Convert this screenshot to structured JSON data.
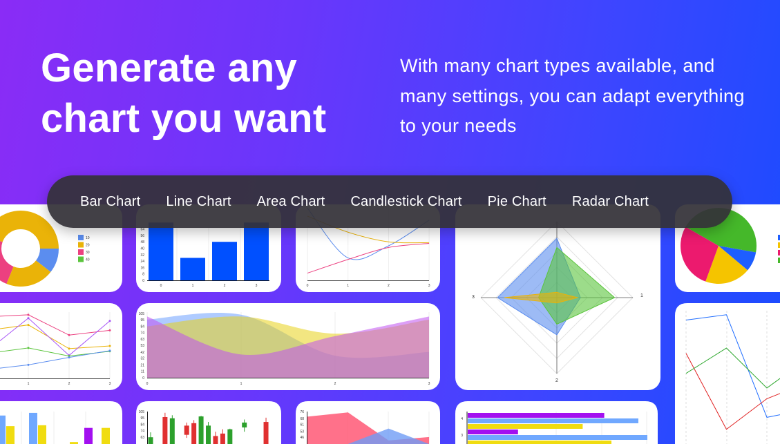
{
  "hero": {
    "title_line1": "Generate any",
    "title_line2": "chart you want",
    "subtitle": "With many chart types available, and many settings, you can adapt everything to your needs"
  },
  "nav": {
    "items": [
      {
        "label": "Bar Chart"
      },
      {
        "label": "Line Chart"
      },
      {
        "label": "Area Chart"
      },
      {
        "label": "Candlestick Chart"
      },
      {
        "label": "Pie Chart"
      },
      {
        "label": "Radar Chart"
      }
    ]
  },
  "colors": {
    "blue": "#5b8def",
    "yellow": "#eab308",
    "pink": "#ec4080",
    "green": "#5ac43c",
    "bar_blue": "#0050ff",
    "purple": "#a310f0",
    "light_blue": "#70a8ff",
    "bright_yellow": "#f0dc10",
    "red": "#e03030",
    "candle_green": "#2ca02c"
  },
  "thumbnails": {
    "donut": {
      "slices": [
        {
          "value": 38,
          "color": "#5b8def"
        },
        {
          "value": 74,
          "color": "#eab308"
        },
        {
          "value": 88,
          "color": "#ec4080"
        },
        {
          "value": 160,
          "color": "#eab308"
        }
      ],
      "legend": [
        {
          "label": "10",
          "color": "#5b8def"
        },
        {
          "label": "20",
          "color": "#eab308"
        },
        {
          "label": "30",
          "color": "#ec4080"
        },
        {
          "label": "40",
          "color": "#5ac43c"
        }
      ]
    },
    "bar": {
      "y_ticks": [
        "0",
        "8",
        "16",
        "24",
        "32",
        "40",
        "48",
        "56",
        "64"
      ],
      "x_ticks": [
        "0",
        "1",
        "2",
        "3"
      ],
      "values": [
        72,
        28,
        48,
        72
      ],
      "color": "#0050ff"
    },
    "line_top": {
      "x_ticks": [
        "0",
        "1",
        "2",
        "3"
      ],
      "series": [
        {
          "color": "#5b8def",
          "values": [
            90,
            28,
            43,
            75
          ]
        },
        {
          "color": "#eab308",
          "values": [
            80,
            60,
            48,
            47
          ]
        },
        {
          "color": "#ec4080",
          "values": [
            9,
            26,
            41,
            46
          ]
        }
      ]
    },
    "radar": {
      "axis_labels": [
        "1",
        "2",
        "3"
      ],
      "series": [
        {
          "color": "#5b8def",
          "values": [
            78,
            31,
            49,
            78
          ]
        },
        {
          "color": "#5ac43c",
          "values": [
            66,
            76,
            35,
            24
          ]
        },
        {
          "color": "#eab308",
          "values": [
            7,
            27,
            7,
            69
          ]
        }
      ]
    },
    "pie": {
      "slices": [
        {
          "value": 160,
          "color": "#45b82a"
        },
        {
          "value": 30,
          "color": "#1e5eff"
        },
        {
          "value": 70,
          "color": "#f5c400"
        },
        {
          "value": 100,
          "color": "#ec1a6e"
        }
      ]
    },
    "line_mid": {
      "x_ticks": [
        "1",
        "2",
        "3"
      ],
      "series": [
        {
          "color": "#ec4080",
          "values": [
            91,
            94,
            64,
            71
          ]
        },
        {
          "color": "#eab308",
          "values": [
            71,
            79,
            44,
            48
          ]
        },
        {
          "color": "#a855f7",
          "values": [
            41,
            89,
            34,
            85
          ]
        },
        {
          "color": "#5ac43c",
          "values": [
            37,
            45,
            33,
            40
          ]
        },
        {
          "color": "#5b8def",
          "values": [
            13,
            20,
            31,
            41
          ]
        }
      ]
    },
    "area": {
      "y_ticks": [
        "0",
        "11",
        "21",
        "32",
        "42",
        "53",
        "63",
        "74",
        "84",
        "95",
        "105"
      ],
      "x_ticks": [
        "0",
        "1",
        "2",
        "3"
      ],
      "series": [
        {
          "color": "#6ea0ff",
          "values": [
            95,
            103,
            36,
            42
          ]
        },
        {
          "color": "#e8d21a",
          "values": [
            84,
            100,
            72,
            95
          ]
        },
        {
          "color": "#c050f0",
          "values": [
            100,
            38,
            68,
            100
          ]
        }
      ]
    },
    "line_right": {
      "series": [
        {
          "color": "#1e6cff",
          "values": [
            93,
            97,
            20,
            26
          ]
        },
        {
          "color": "#e02020",
          "values": [
            68,
            11,
            34,
            46
          ]
        },
        {
          "color": "#2ea82e",
          "values": [
            53,
            72,
            42,
            64
          ]
        }
      ]
    },
    "grouped_bar": {
      "series": [
        {
          "color": "#a310f0",
          "values": [
            0,
            0,
            0,
            63
          ]
        },
        {
          "color": "#70a8ff",
          "values": [
            91,
            97,
            0,
            0
          ]
        },
        {
          "color": "#f0dc10",
          "values": [
            67,
            69,
            31,
            63
          ]
        }
      ]
    },
    "candlestick": {
      "y_ticks": [
        "105",
        "95",
        "84",
        "74",
        "63"
      ],
      "candles": [
        {
          "i": 0,
          "o": 40,
          "c": 63,
          "h": 71,
          "l": 35
        },
        {
          "i": 2,
          "o": 96,
          "c": 40,
          "h": 103,
          "l": 35
        },
        {
          "i": 3,
          "o": 40,
          "c": 94,
          "h": 99,
          "l": 35
        },
        {
          "i": 5,
          "o": 82,
          "c": 67,
          "h": 87,
          "l": 62
        },
        {
          "i": 6,
          "o": 86,
          "c": 40,
          "h": 91,
          "l": 35
        },
        {
          "i": 7,
          "o": 40,
          "c": 97,
          "h": 98,
          "l": 35
        },
        {
          "i": 8,
          "o": 40,
          "c": 82,
          "h": 88,
          "l": 35
        },
        {
          "i": 9,
          "o": 65,
          "c": 40,
          "h": 72,
          "l": 35
        },
        {
          "i": 10,
          "o": 69,
          "c": 40,
          "h": 76,
          "l": 35
        },
        {
          "i": 11,
          "o": 40,
          "c": 76,
          "h": 77,
          "l": 35
        },
        {
          "i": 13,
          "o": 79,
          "c": 87,
          "h": 92,
          "l": 72
        },
        {
          "i": 16,
          "o": 88,
          "c": 40,
          "h": 95,
          "l": 35
        }
      ]
    },
    "area_small": {
      "y_ticks": [
        "76",
        "68",
        "61",
        "53",
        "46"
      ],
      "series": [
        {
          "color": "#ff4d6d",
          "values": [
            70,
            75,
            42,
            46
          ]
        },
        {
          "color": "#6f9cf5",
          "values": [
            10,
            30,
            56,
            25
          ]
        }
      ]
    },
    "hbar": {
      "y_ticks": [
        "4",
        "3"
      ],
      "groups": [
        {
          "values": [
            76,
            95,
            64
          ]
        },
        {
          "values": [
            28,
            100,
            80
          ]
        }
      ],
      "colors": [
        "#a310f0",
        "#70a8ff",
        "#f0dc10"
      ]
    }
  }
}
